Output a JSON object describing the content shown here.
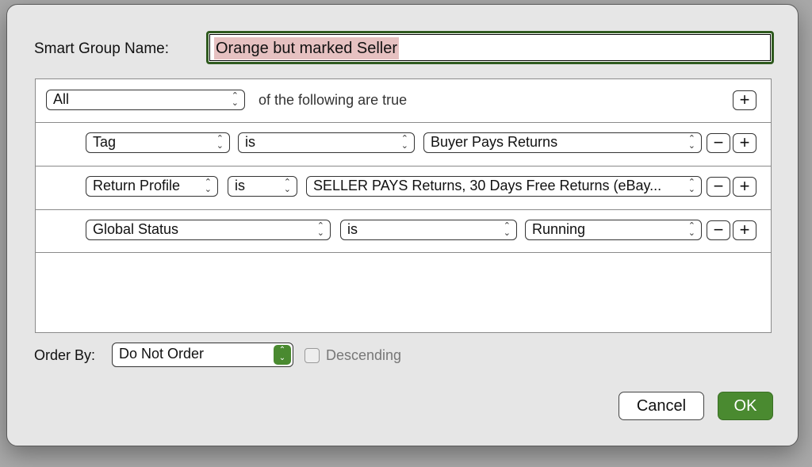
{
  "name_label": "Smart Group Name:",
  "name_value": "Orange but marked Seller",
  "header": {
    "match": "All",
    "suffix": "of the following are true",
    "add": "+"
  },
  "rules": [
    {
      "field": "Tag",
      "op": "is",
      "value": "Buyer Pays Returns"
    },
    {
      "field": "Return Profile",
      "op": "is",
      "value": "SELLER PAYS Returns, 30 Days Free Returns (eBay..."
    },
    {
      "field": "Global Status",
      "op": "is",
      "value": "Running"
    }
  ],
  "remove_symbol": "−",
  "add_symbol": "+",
  "order": {
    "label": "Order By:",
    "value": "Do Not Order",
    "descending_label": "Descending",
    "descending_checked": false
  },
  "buttons": {
    "cancel": "Cancel",
    "ok": "OK"
  },
  "colors": {
    "accent": "#4a8a30",
    "focus_ring": "#2f5a1f",
    "selection": "#e6c1c1"
  }
}
